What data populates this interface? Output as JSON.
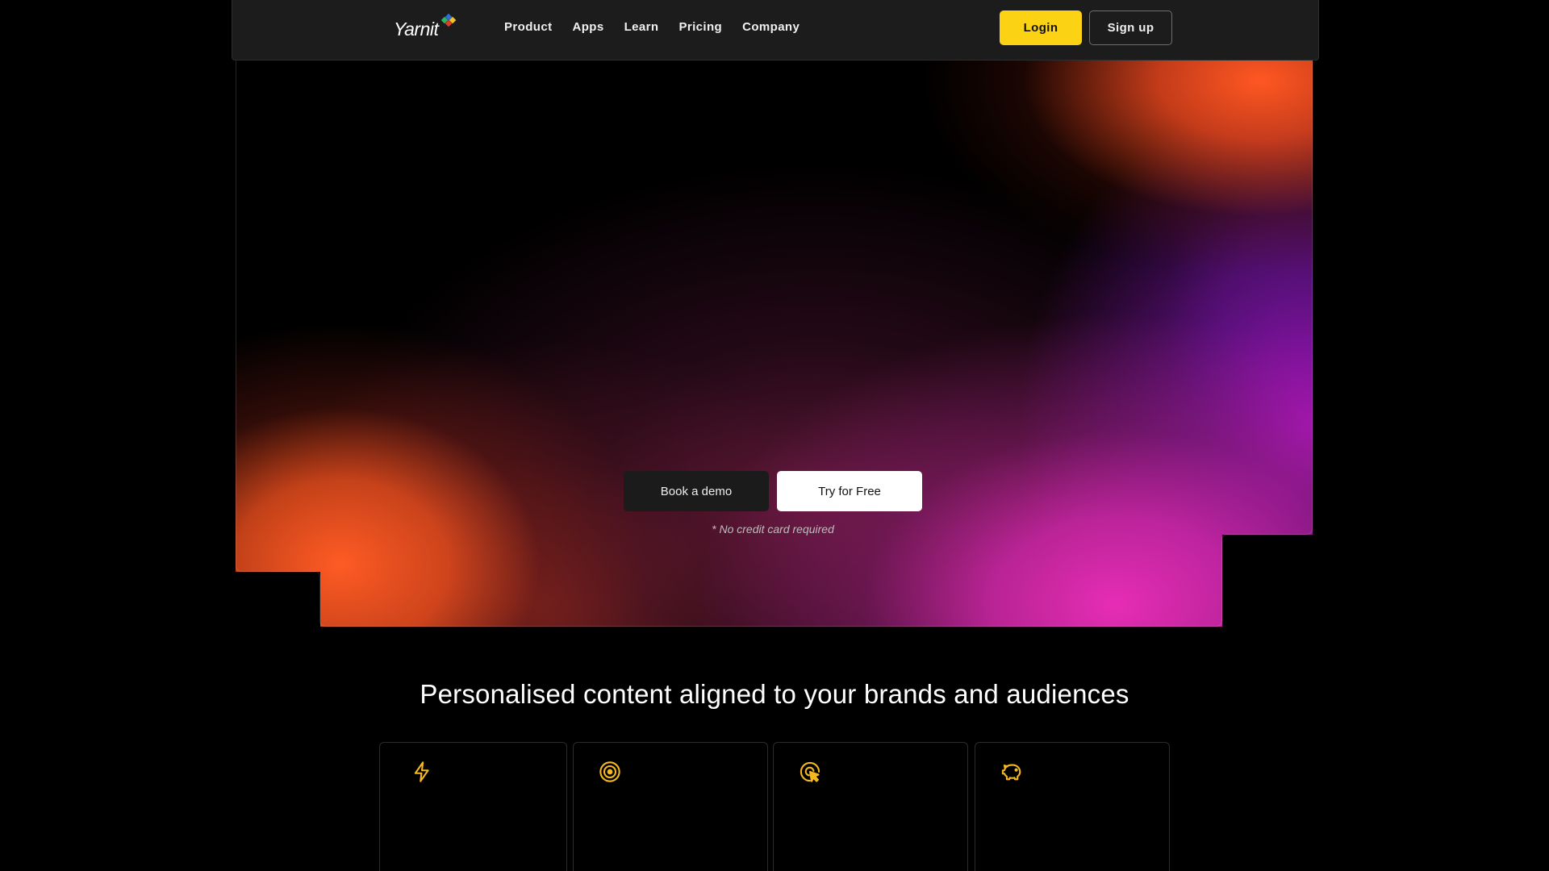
{
  "brand": {
    "name": "Yarnit",
    "logo_colors": [
      "#e23b2c",
      "#f6c325",
      "#2d6fd6",
      "#2fb567"
    ]
  },
  "nav": {
    "items": [
      {
        "label": "Product"
      },
      {
        "label": "Apps"
      },
      {
        "label": "Learn"
      },
      {
        "label": "Pricing"
      },
      {
        "label": "Company"
      }
    ],
    "login_label": "Login",
    "signup_label": "Sign up"
  },
  "hero": {
    "demo_label": "Book a demo",
    "free_label": "Try for Free",
    "note": "* No credit card required"
  },
  "features": {
    "title": "Personalised content aligned to your brands and audiences",
    "cards": [
      {
        "icon": "lightning-icon"
      },
      {
        "icon": "target-icon"
      },
      {
        "icon": "cursor-click-icon"
      },
      {
        "icon": "piggy-bank-icon"
      }
    ]
  },
  "colors": {
    "accent": "#fcd214",
    "icon": "#f5b820",
    "background": "#000000",
    "navbar": "#1c1c1c"
  }
}
